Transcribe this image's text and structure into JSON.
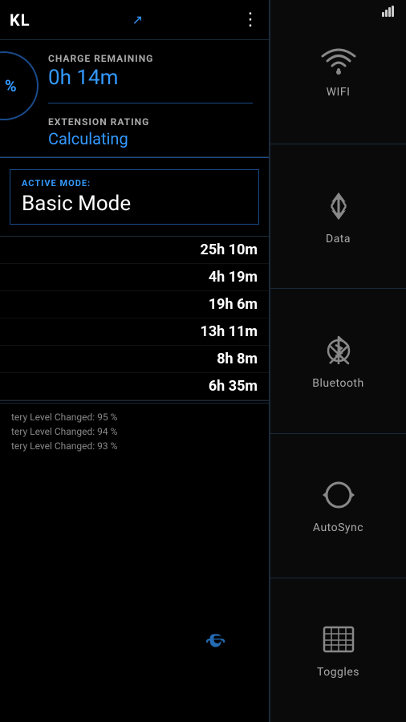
{
  "statusBar": {
    "signal": "▾"
  },
  "header": {
    "title": "KL",
    "menuIcon": "⋮"
  },
  "batterySection": {
    "chargeLabel": "CHARGE REMAINING",
    "chargeValue": "0h 14m",
    "extensionLabel": "EXTENSION RATING",
    "extensionValue": "Calculating",
    "percentDisplay": "%"
  },
  "activeMode": {
    "label": "ACTIVE MODE:",
    "value": "Basic Mode"
  },
  "stats": [
    {
      "value": "25h 10m"
    },
    {
      "value": "4h 19m"
    },
    {
      "value": "19h 6m"
    },
    {
      "value": "13h 11m"
    },
    {
      "value": "8h 8m"
    },
    {
      "value": "6h 35m"
    }
  ],
  "log": [
    {
      "text": "tery Level Changed: 95 %"
    },
    {
      "text": "tery Level Changed: 94 %"
    },
    {
      "text": "tery Level Changed: 93 %"
    }
  ],
  "rightPanel": {
    "items": [
      {
        "id": "wifi",
        "label": "WIFI"
      },
      {
        "id": "data",
        "label": "Data"
      },
      {
        "id": "bluetooth",
        "label": "Bluetooth"
      },
      {
        "id": "autosync",
        "label": "AutoSync"
      },
      {
        "id": "toggles",
        "label": "Toggles"
      }
    ]
  }
}
